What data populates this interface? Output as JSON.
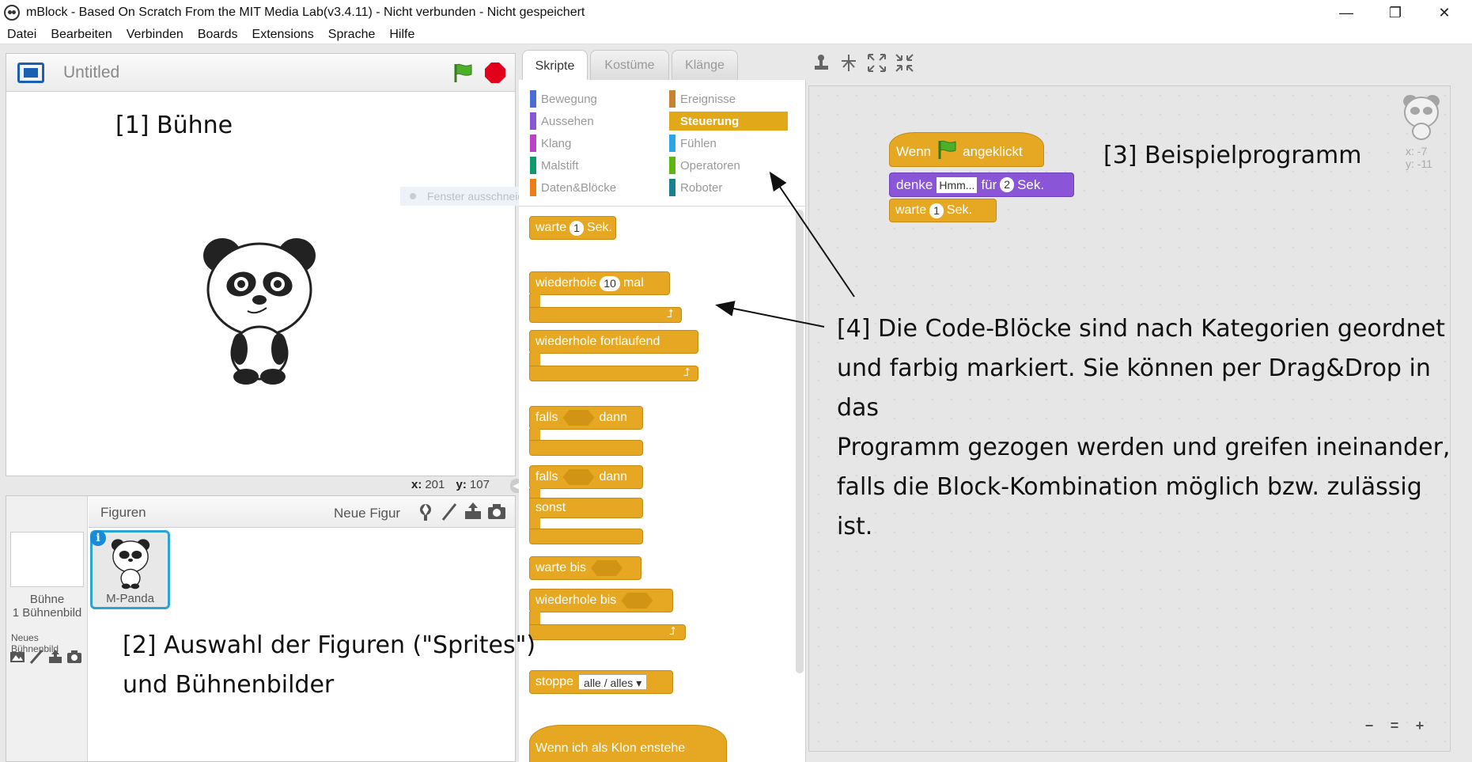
{
  "window": {
    "title": "mBlock - Based On Scratch From the MIT Media Lab(v3.4.11) - Nicht verbunden - Nicht gespeichert",
    "min_glyph": "—",
    "max_glyph": "❐",
    "close_glyph": "✕"
  },
  "menu": [
    "Datei",
    "Bearbeiten",
    "Verbinden",
    "Boards",
    "Extensions",
    "Sprache",
    "Hilfe"
  ],
  "stage": {
    "project_name": "Untitled",
    "window_cut_hint": "Fenster ausschneiden",
    "coords": {
      "x_label": "x:",
      "x_value": "201",
      "y_label": "y:",
      "y_value": "107"
    }
  },
  "sprites": {
    "header_label": "Figuren",
    "new_figure_label": "Neue Figur",
    "stage_label_line1": "Bühne",
    "stage_label_line2": "1 Bühnenbild",
    "new_backdrop_label": "Neues Bühnenbild",
    "selected_sprite": "M-Panda",
    "info_badge": "i"
  },
  "tabs": [
    "Skripte",
    "Kostüme",
    "Klänge"
  ],
  "categories": {
    "left": [
      {
        "label": "Bewegung",
        "color": "#4a6cd4"
      },
      {
        "label": "Aussehen",
        "color": "#8a55d7"
      },
      {
        "label": "Klang",
        "color": "#bb42c3"
      },
      {
        "label": "Malstift",
        "color": "#0e9a6c"
      },
      {
        "label": "Daten&Blöcke",
        "color": "#ee7d16"
      }
    ],
    "right": [
      {
        "label": "Ereignisse",
        "color": "#c88330"
      },
      {
        "label": "Steuerung",
        "color": "#e1a91a",
        "selected": true
      },
      {
        "label": "Fühlen",
        "color": "#2ca5e2"
      },
      {
        "label": "Operatoren",
        "color": "#5cb712"
      },
      {
        "label": "Roboter",
        "color": "#1a7f8e"
      }
    ]
  },
  "palette_blocks": {
    "wait": {
      "pre": "warte",
      "num": "1",
      "post": "Sek."
    },
    "repeat": {
      "pre": "wiederhole",
      "num": "10",
      "post": "mal"
    },
    "forever": "wiederhole fortlaufend",
    "if_then": {
      "pre": "falls",
      "post": "dann"
    },
    "if_else": {
      "pre": "falls",
      "post": "dann",
      "else": "sonst"
    },
    "wait_until": "warte bis",
    "repeat_until": "wiederhole bis",
    "stop": {
      "label": "stoppe",
      "option": "alle / alles ▾"
    },
    "clone_hat": "Wenn ich als Klon enstehe",
    "loop_arrow": "⮥"
  },
  "script": {
    "hat": {
      "pre": "Wenn",
      "post": "angeklickt"
    },
    "think": {
      "pre": "denke",
      "text": "Hmm...",
      "mid": "für",
      "num": "2",
      "post": "Sek."
    },
    "wait": {
      "pre": "warte",
      "num": "1",
      "post": "Sek."
    },
    "sprite_pos": {
      "x": "x: -7",
      "y": "y: -11"
    }
  },
  "zoom": {
    "out": "−",
    "reset": "=",
    "in": "+"
  },
  "annotations": {
    "stage": "[1] Bühne",
    "sprites_line1": "[2] Auswahl der Figuren (\"Sprites\")",
    "sprites_line2": "und Bühnenbilder",
    "example": "[3] Beispielprogramm",
    "blocks_line1": "[4] Die Code-Blöcke sind nach Kategorien geordnet",
    "blocks_line2": "und farbig markiert. Sie können per Drag&Drop in das",
    "blocks_line3": "Programm gezogen werden und greifen ineinander,",
    "blocks_line4": "falls die Block-Kombination möglich bzw. zulässig ist."
  },
  "colors": {
    "control": "#e6a822",
    "looks": "#8a55d7",
    "accent_blue": "#1a5fb4",
    "selection": "#2aa3d8"
  }
}
